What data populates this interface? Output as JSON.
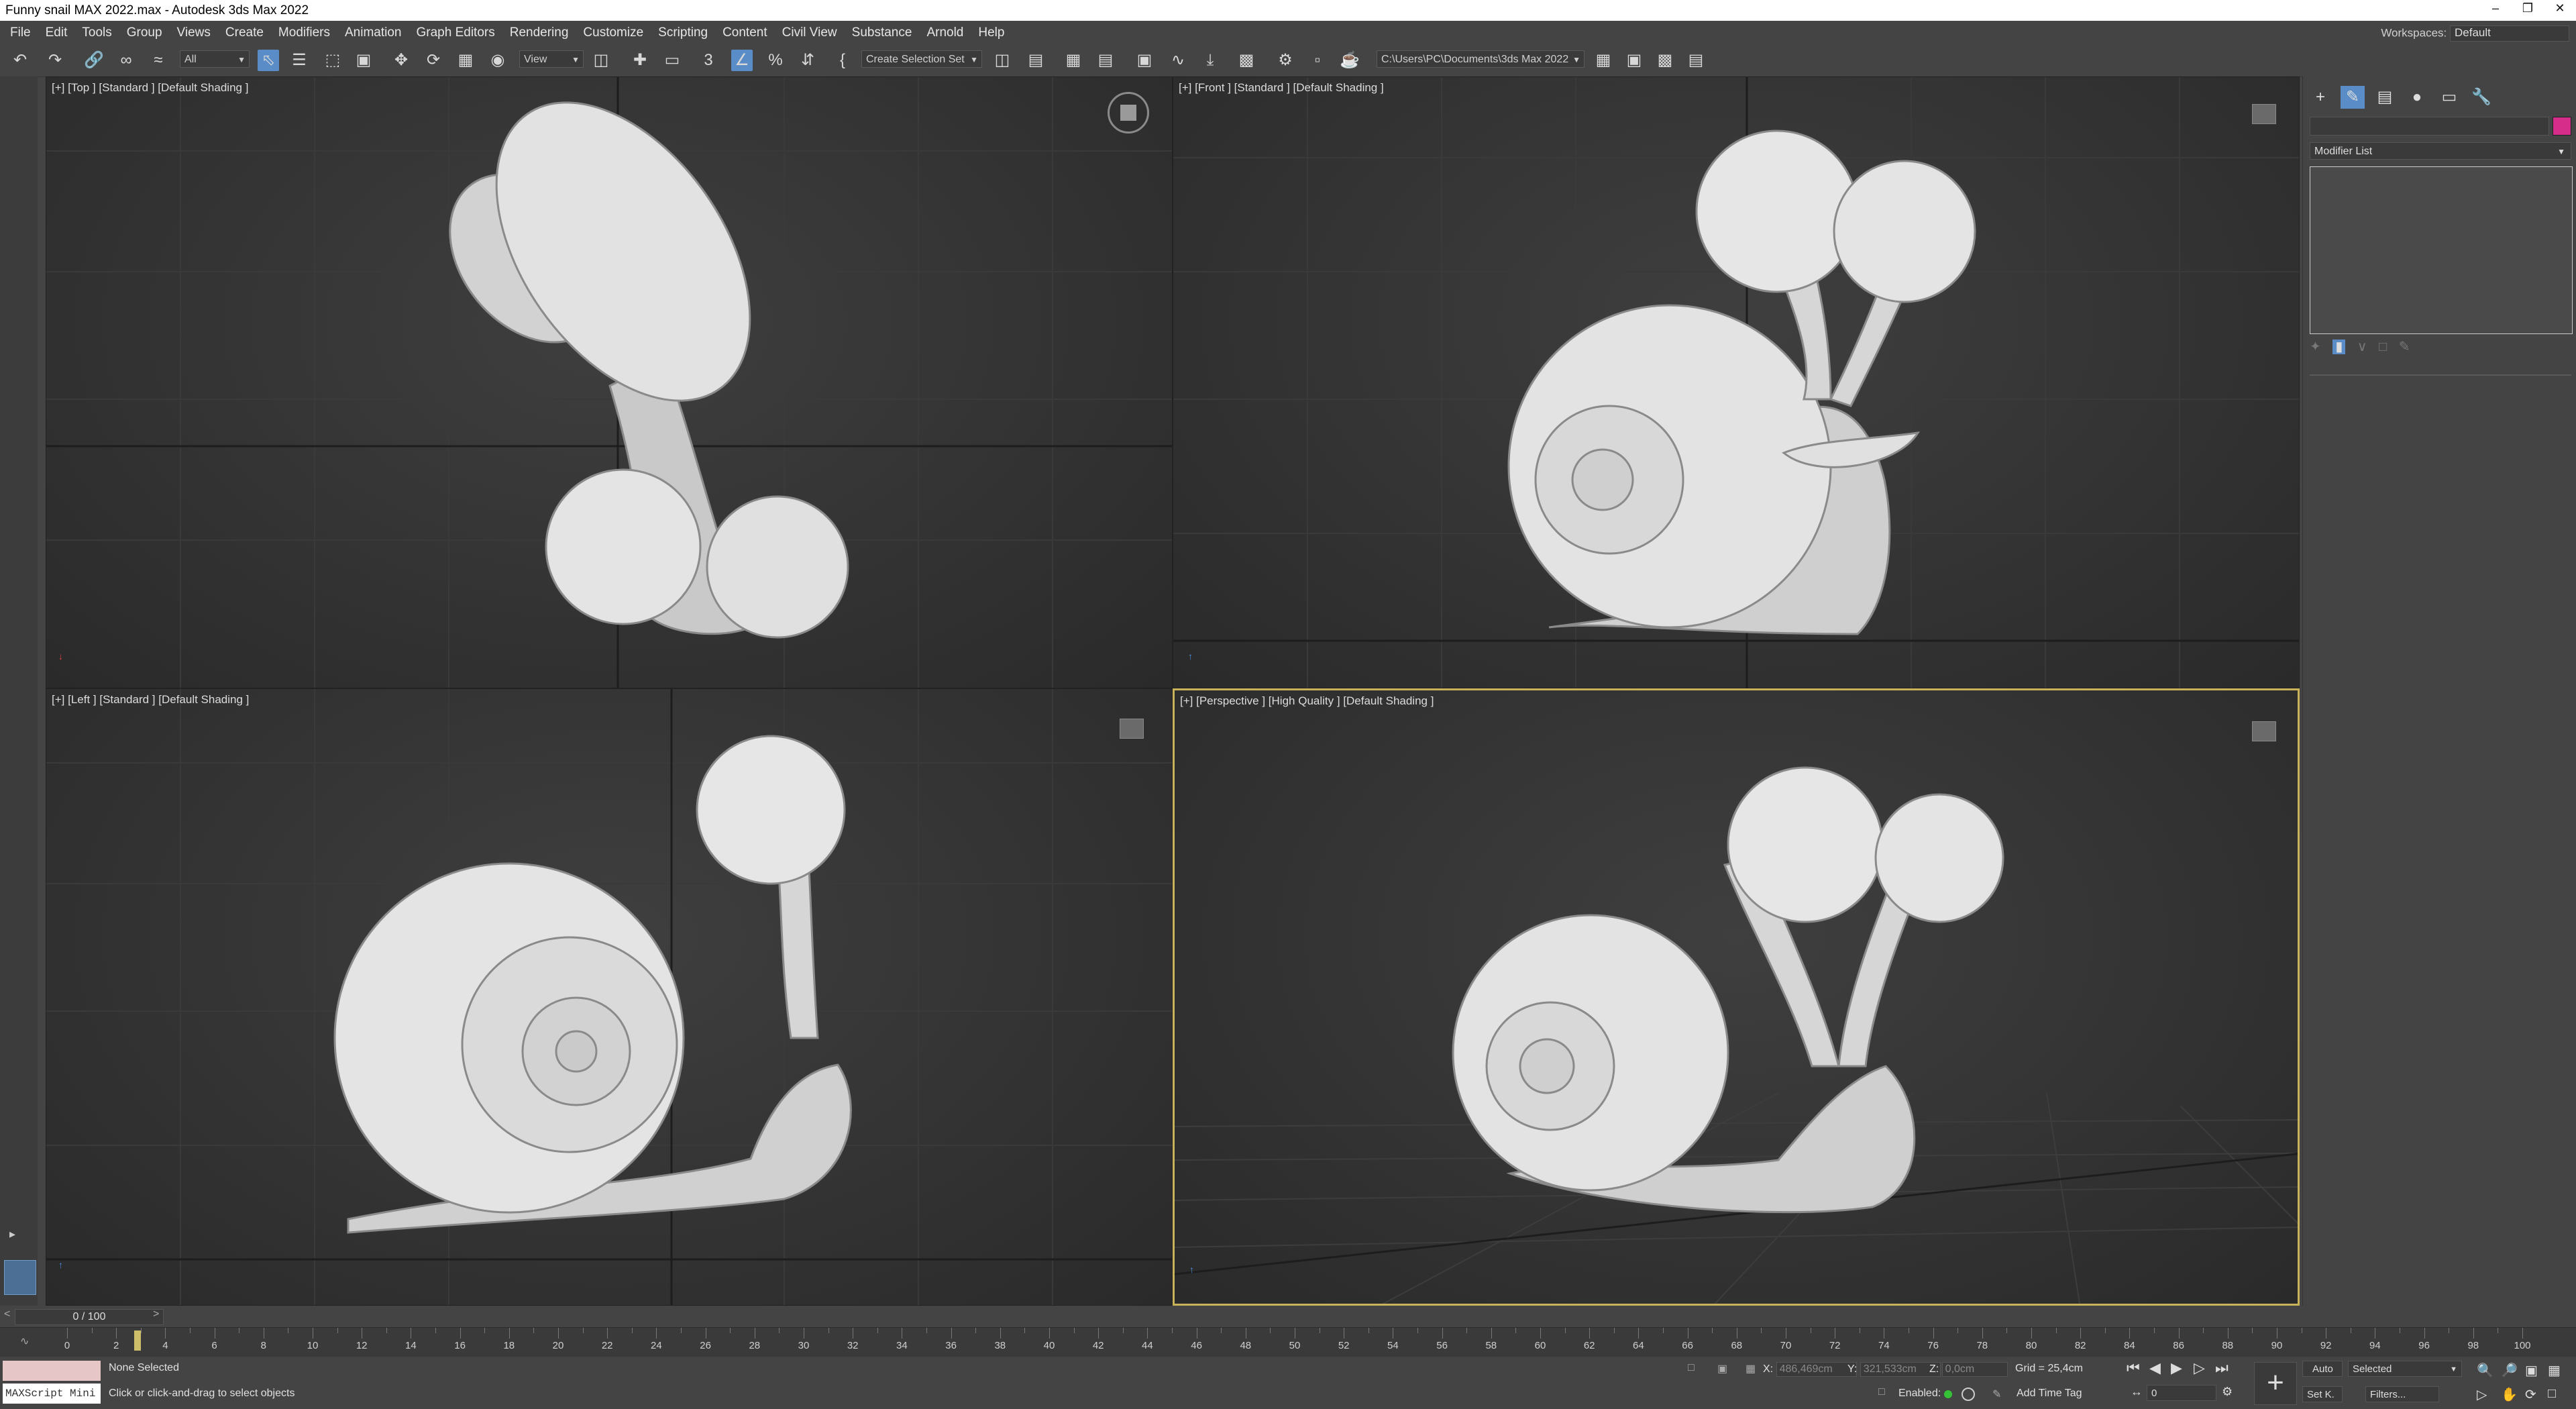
{
  "window": {
    "title": "Funny snail MAX 2022.max - Autodesk 3ds Max 2022"
  },
  "menu": {
    "items": [
      "File",
      "Edit",
      "Tools",
      "Group",
      "Views",
      "Create",
      "Modifiers",
      "Animation",
      "Graph Editors",
      "Rendering",
      "Customize",
      "Scripting",
      "Content",
      "Civil View",
      "Substance",
      "Arnold",
      "Help"
    ],
    "workspaces_label": "Workspaces:",
    "workspace_value": "Default"
  },
  "toolbar": {
    "selection_filter": "All",
    "ref_coord": "View",
    "selection_set": "Create Selection Set",
    "project_path": "C:\\Users\\PC\\Documents\\3ds Max 2022"
  },
  "viewports": {
    "top": {
      "label": "[+] [Top ] [Standard ] [Default Shading ]"
    },
    "front": {
      "label": "[+] [Front ] [Standard ] [Default Shading ]"
    },
    "left": {
      "label": "[+] [Left ] [Standard ] [Default Shading ]"
    },
    "perspective": {
      "label": "[+] [Perspective ] [High Quality ] [Default Shading ]"
    }
  },
  "command_panel": {
    "modifier_list": "Modifier List",
    "swatch_color": "#d62d8a"
  },
  "timeline": {
    "frame_display": "0 / 100",
    "ticks": [
      "0",
      "2",
      "4",
      "6",
      "8",
      "10",
      "12",
      "14",
      "16",
      "18",
      "20",
      "22",
      "24",
      "26",
      "28",
      "30",
      "32",
      "34",
      "36",
      "38",
      "40",
      "42",
      "44",
      "46",
      "48",
      "50",
      "52",
      "54",
      "56",
      "58",
      "60",
      "62",
      "64",
      "66",
      "68",
      "70",
      "72",
      "74",
      "76",
      "78",
      "80",
      "82",
      "84",
      "86",
      "88",
      "90",
      "92",
      "94",
      "96",
      "98",
      "100"
    ]
  },
  "status": {
    "maxscript_label": "MAXScript Mini",
    "selection": "None Selected",
    "prompt": "Click or click-and-drag to select objects",
    "x_label": "X:",
    "x_value": "486,469cm",
    "y_label": "Y:",
    "y_value": "321,533cm",
    "z_label": "Z:",
    "z_value": "0,0cm",
    "grid": "Grid = 25,4cm",
    "enabled_label": "Enabled:",
    "add_time_tag": "Add Time Tag",
    "auto_label": "Auto",
    "set_key_label": "Set K.",
    "key_filter": "Selected",
    "filters_label": "Filters...",
    "current_frame": "0"
  }
}
